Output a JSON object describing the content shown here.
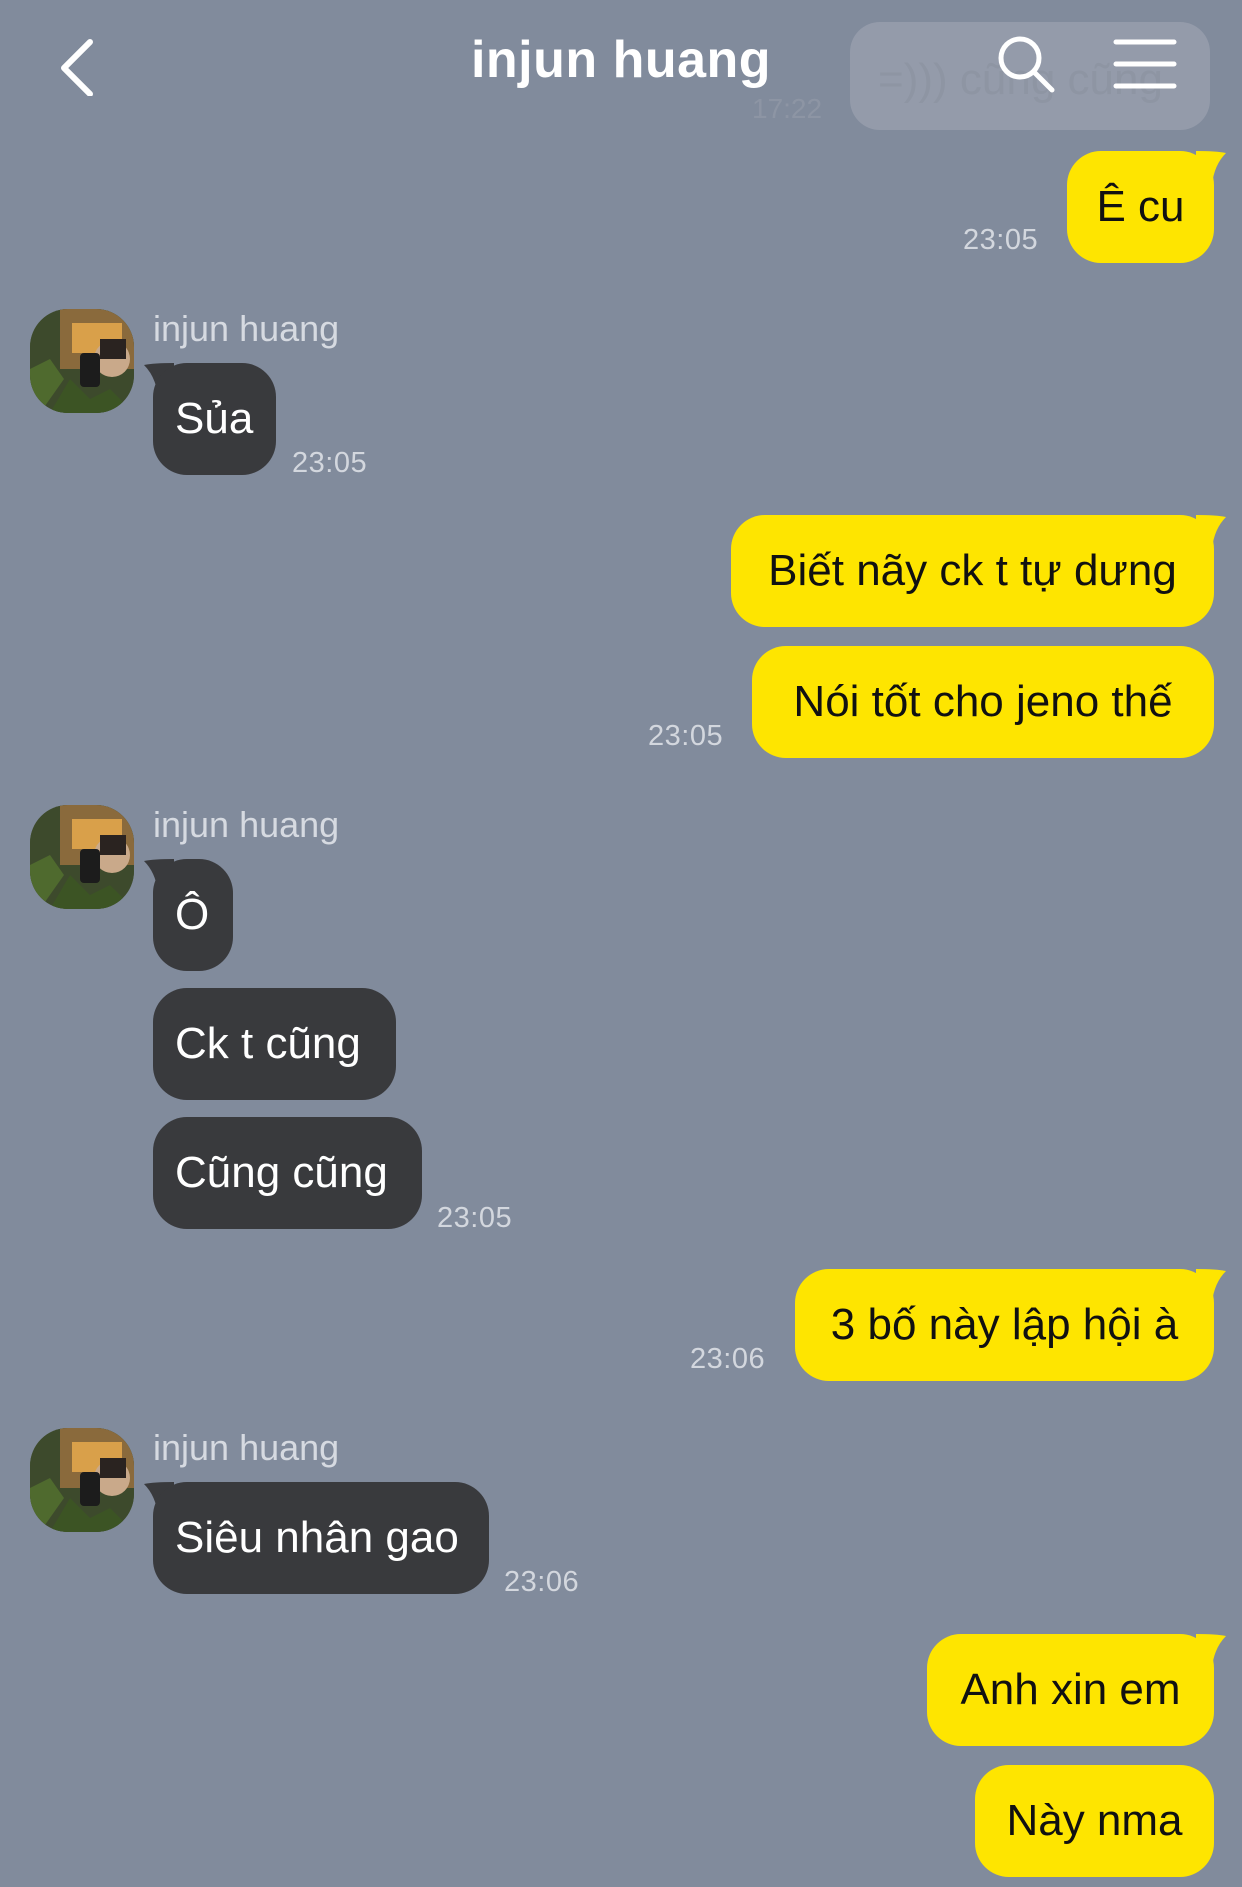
{
  "header": {
    "title": "injun huang",
    "ghost_preview_text": "=))) cũng cũng",
    "ghost_preview_time": "17:22"
  },
  "colors": {
    "background": "#818b9c",
    "my_bubble": "#fee500",
    "their_bubble": "#393a3d",
    "timestamp": "#d3d7de"
  },
  "icons": {
    "back": "back-chevron-icon",
    "search": "search-icon",
    "menu": "hamburger-menu-icon"
  },
  "messages": [
    {
      "sender": "me",
      "text": "Ê cu",
      "time": "23:05"
    },
    {
      "sender": "injun huang",
      "text": "Sủa",
      "time": "23:05"
    },
    {
      "sender": "me",
      "text": "Biết nãy ck t tự dưng",
      "time": ""
    },
    {
      "sender": "me",
      "text": "Nói tốt cho jeno thế",
      "time": "23:05"
    },
    {
      "sender": "injun huang",
      "text": "Ô",
      "time": ""
    },
    {
      "sender": "injun huang",
      "text": "Ck t cũng",
      "time": ""
    },
    {
      "sender": "injun huang",
      "text": "Cũng cũng",
      "time": "23:05"
    },
    {
      "sender": "me",
      "text": "3 bố này lập hội à",
      "time": "23:06"
    },
    {
      "sender": "injun huang",
      "text": "Siêu nhân gao",
      "time": "23:06"
    },
    {
      "sender": "me",
      "text": "Anh xin em",
      "time": ""
    },
    {
      "sender": "me",
      "text": "Này nma",
      "time": ""
    }
  ],
  "contact": {
    "name_label_1": "injun huang",
    "name_label_2": "injun huang",
    "name_label_3": "injun huang"
  }
}
